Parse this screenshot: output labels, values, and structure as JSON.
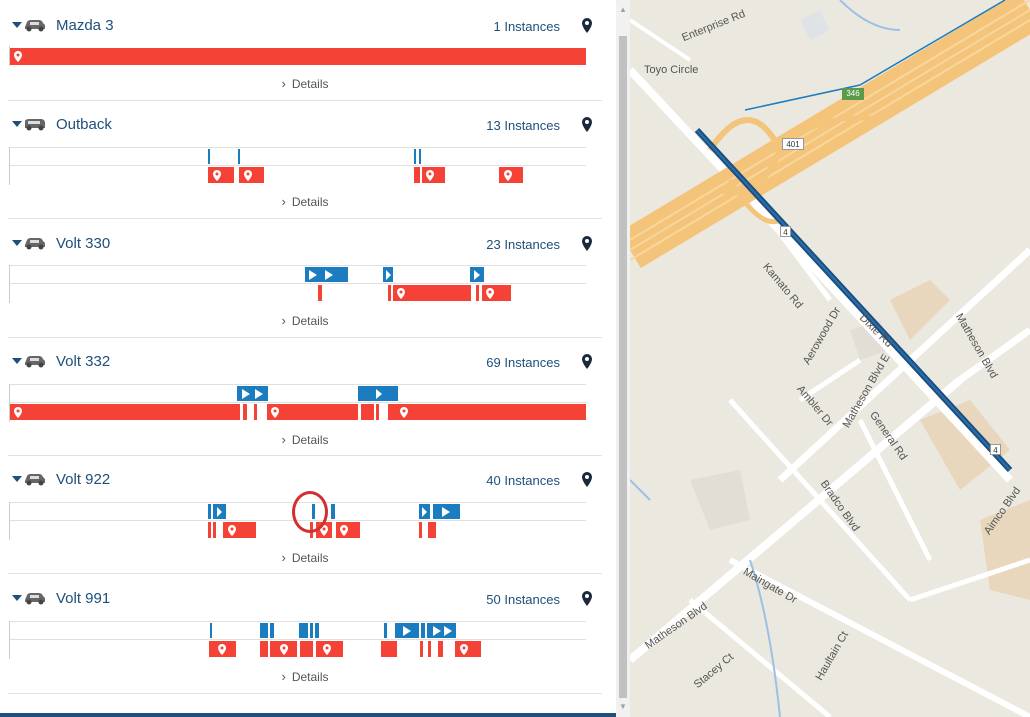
{
  "colors": {
    "accent": "#1f4f7a",
    "stop": "#f44336",
    "trip": "#1b7cbf",
    "map_bg": "#ebe8e0",
    "highway": "#f4c47a"
  },
  "icons": {
    "caret": "caret-down-icon",
    "car": "car-icon",
    "locate": "map-pin-icon",
    "details": "chevron-right-icon"
  },
  "vehicles": [
    {
      "name": "Mazda 3",
      "instances": "1 Instances",
      "details": "Details"
    },
    {
      "name": "Outback",
      "instances": "13 Instances",
      "details": "Details"
    },
    {
      "name": "Volt 330",
      "instances": "23 Instances",
      "details": "Details"
    },
    {
      "name": "Volt 332",
      "instances": "69 Instances",
      "details": "Details"
    },
    {
      "name": "Volt 922",
      "instances": "40 Instances",
      "details": "Details"
    },
    {
      "name": "Volt 991",
      "instances": "50 Instances",
      "details": "Details"
    }
  ],
  "map": {
    "labels": [
      "Enterprise Rd",
      "Toyo Circle",
      "Kamato Rd",
      "Aerowood Dr",
      "Dixie Rd",
      "Matheson Blvd",
      "Matheson Blvd E",
      "Ambler Dr",
      "General Rd",
      "Bradco Blvd",
      "Maingate Dr",
      "Haultain Ct",
      "Stacey Ct",
      "Aimco Blvd",
      "Matheson Blvd"
    ],
    "shields": [
      "346",
      "401",
      "4",
      "4"
    ]
  }
}
